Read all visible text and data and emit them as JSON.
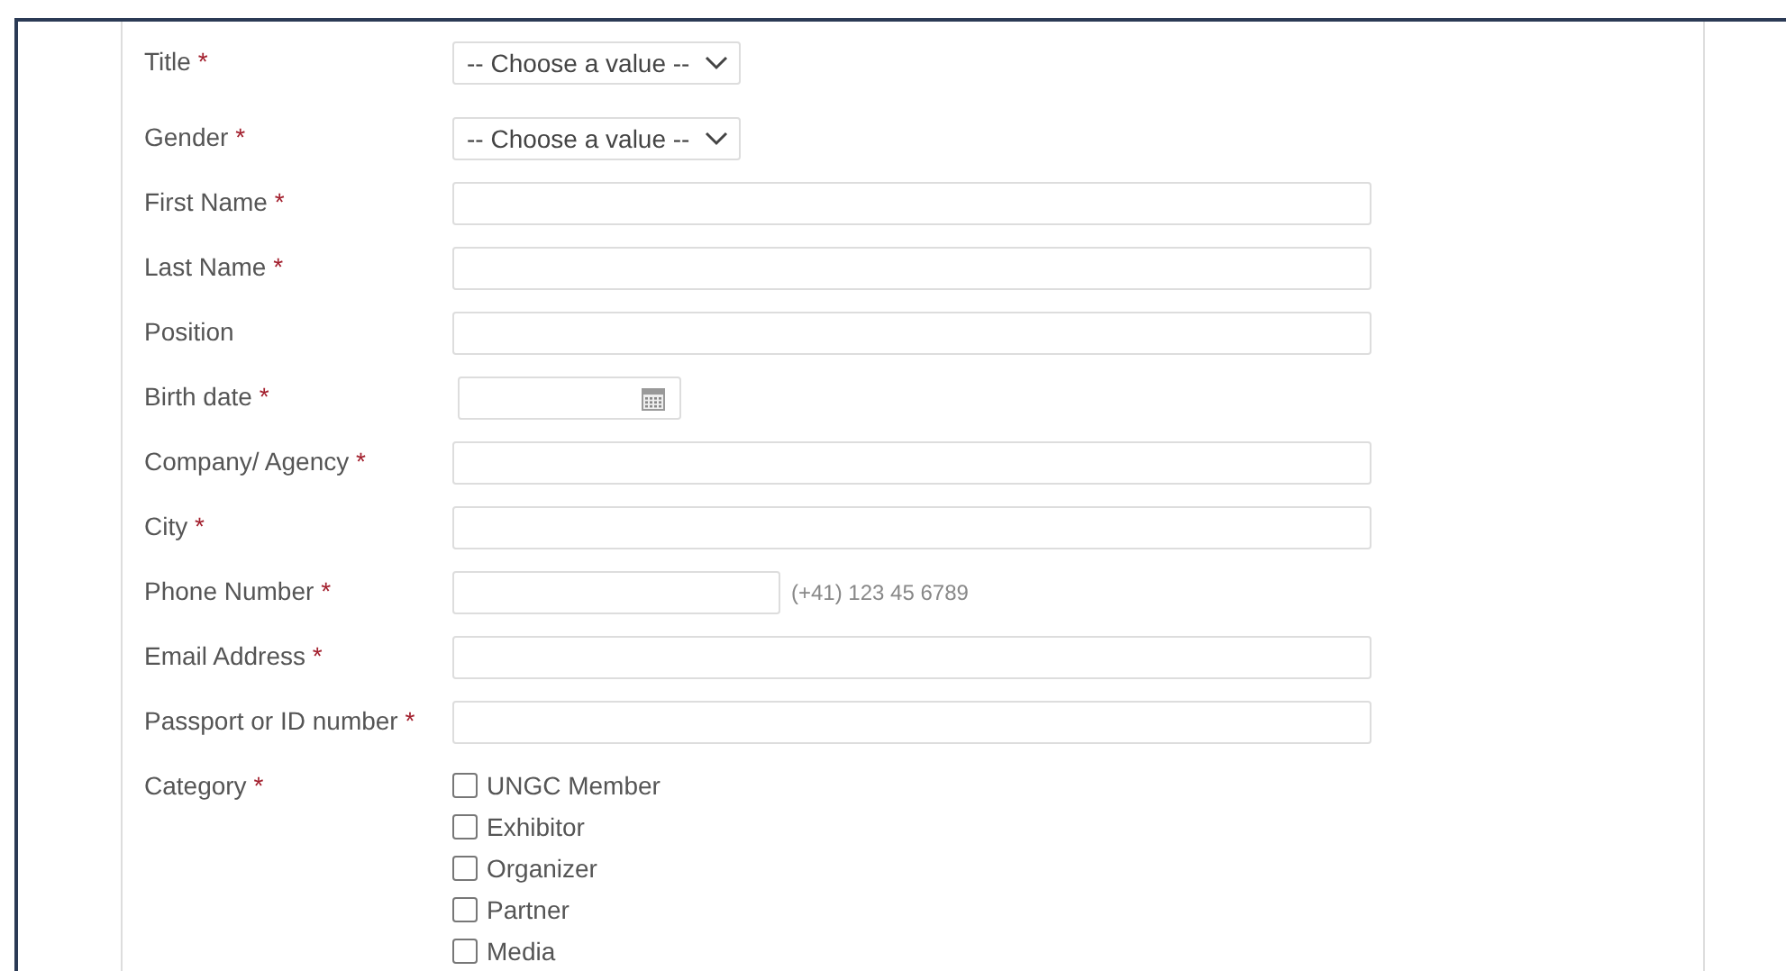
{
  "fields": [
    {
      "kind": "select",
      "label": "Title",
      "mark": "*",
      "value": "-- Choose a value --"
    },
    {
      "kind": "select",
      "label": "Gender",
      "mark": "*",
      "value": "-- Choose a value --"
    },
    {
      "kind": "text",
      "label": "First Name",
      "mark": "*"
    },
    {
      "kind": "text",
      "label": "Last Name",
      "mark": "*"
    },
    {
      "kind": "text",
      "label": "Position"
    },
    {
      "kind": "date",
      "label": "Birth date",
      "mark": "*"
    },
    {
      "kind": "text",
      "label": "Company/ Agency",
      "mark": "*"
    },
    {
      "kind": "text",
      "label": "City",
      "mark": "*"
    },
    {
      "kind": "phone",
      "label": "Phone Number",
      "mark": "*",
      "hint": "(+41) 123 45 6789"
    },
    {
      "kind": "text",
      "label": "Email Address",
      "mark": "*"
    },
    {
      "kind": "text",
      "label": "Passport or ID number",
      "mark": "*"
    },
    {
      "kind": "checkboxes",
      "label": "Category",
      "mark": "*",
      "options": [
        {
          "label": "UNGC Member",
          "checked": false
        },
        {
          "label": "Exhibitor",
          "checked": false
        },
        {
          "label": "Organizer",
          "checked": false
        },
        {
          "label": "Partner",
          "checked": false
        },
        {
          "label": "Media",
          "checked": false
        }
      ]
    }
  ]
}
